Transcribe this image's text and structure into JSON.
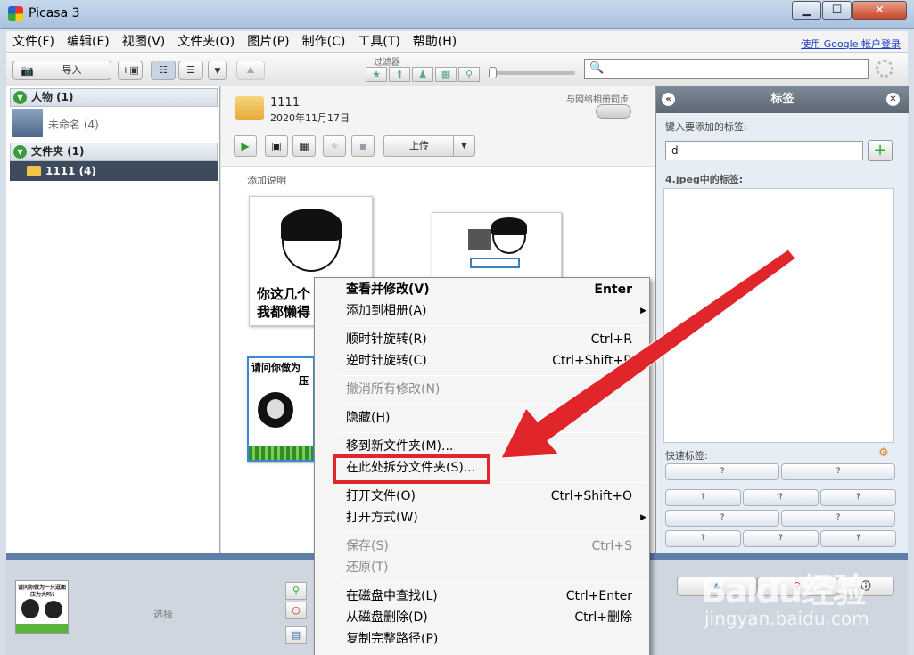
{
  "window": {
    "title": "Picasa 3",
    "min": "▁",
    "max": "☐",
    "close": "✕"
  },
  "menubar": {
    "items": [
      "文件(F)",
      "编辑(E)",
      "视图(V)",
      "文件夹(O)",
      "图片(P)",
      "制作(C)",
      "工具(T)",
      "帮助(H)"
    ],
    "signin": "使用 Google 帐户登录"
  },
  "toolbar": {
    "import": "导入",
    "filter_label": "过滤器",
    "search_placeholder": ""
  },
  "left_panel": {
    "people_header": "人物 (1)",
    "unnamed": "未命名 (4)",
    "folders_header": "文件夹 (1)",
    "folder_item": "1111 (4)"
  },
  "album": {
    "name": "1111",
    "date": "2020年11月17日",
    "sync_label": "与网络相册同步",
    "upload": "上传",
    "caption": "添加说明",
    "thumb1_text": [
      "你这几个",
      "我都懒得"
    ],
    "thumb3_text": [
      "请问你做为",
      "压"
    ]
  },
  "tags_panel": {
    "title": "标签",
    "input_label": "键入要添加的标签:",
    "input_value": "d",
    "file_tags_label": "4.jpeg中的标签:",
    "quick_label": "快速标签:",
    "quick_button": "?"
  },
  "bottom": {
    "tray_label": "选择",
    "tray_text": [
      "请问你做为一只逗图",
      "压力大吗?"
    ]
  },
  "context_menu": {
    "items": [
      {
        "label": "查看并修改(V)",
        "shortcut": "Enter"
      },
      {
        "label": "添加到相册(A)",
        "shortcut": "",
        "submenu": true
      },
      {
        "label": "顺时针旋转(R)",
        "shortcut": "Ctrl+R"
      },
      {
        "label": "逆时针旋转(C)",
        "shortcut": "Ctrl+Shift+R"
      },
      {
        "label": "撤消所有修改(N)",
        "shortcut": ""
      },
      {
        "label": "隐藏(H)",
        "shortcut": ""
      },
      {
        "label": "移到新文件夹(M)...",
        "shortcut": ""
      },
      {
        "label": "在此处拆分文件夹(S)...",
        "shortcut": ""
      },
      {
        "label": "打开文件(O)",
        "shortcut": "Ctrl+Shift+O"
      },
      {
        "label": "打开方式(W)",
        "shortcut": "",
        "submenu": true
      },
      {
        "label": "保存(S)",
        "shortcut": "Ctrl+S"
      },
      {
        "label": "还原(T)",
        "shortcut": ""
      },
      {
        "label": "在磁盘中查找(L)",
        "shortcut": "Ctrl+Enter"
      },
      {
        "label": "从磁盘删除(D)",
        "shortcut": "Ctrl+删除"
      },
      {
        "label": "复制完整路径(P)",
        "shortcut": ""
      }
    ]
  },
  "watermark": {
    "line1": "Baidu经验",
    "line2": "jingyan.baidu.com"
  },
  "colors": {
    "highlight": "#e1262b",
    "folder_selected": "#3e4b5c"
  }
}
